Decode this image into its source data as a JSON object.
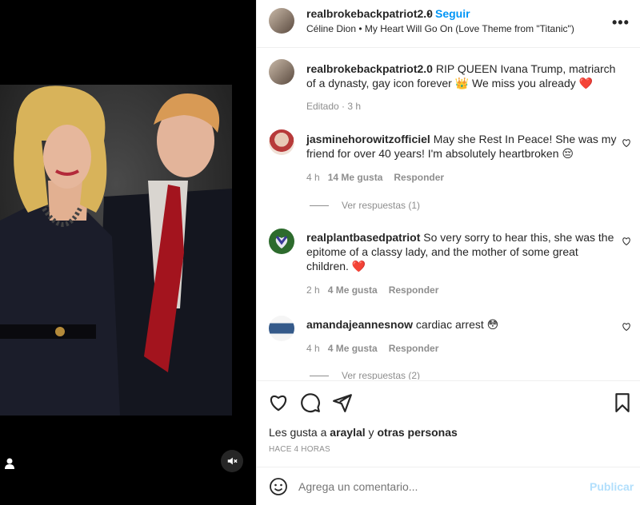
{
  "colors": {
    "accent": "#0095f6",
    "heart": "#ed4956",
    "muted": "#8e8e8e",
    "text": "#262626"
  },
  "media": {
    "user_tag_icon": "user-tag-icon",
    "mute_icon": "speaker-muted-icon"
  },
  "header": {
    "username": "realbrokebackpatriot2.0",
    "dot": "•",
    "follow_label": "Seguir",
    "music": "Céline Dion • My Heart Will Go On (Love Theme from \"Titanic\")",
    "more_icon": "more-options-icon",
    "more_label": "•••"
  },
  "caption": {
    "username": "realbrokebackpatriot2.0",
    "text": " RIP QUEEN Ivana Trump, matriarch of a dynasty, gay icon forever 👑  We miss you already ❤️",
    "meta": "Editado · 3 h"
  },
  "comments": [
    {
      "username": "jasminehorowitzofficiel",
      "text": " May she Rest In Peace! She was my friend for over 40 years! I'm absolutely heartbroken 😔",
      "time": "4 h",
      "likes": "14 Me gusta",
      "reply": "Responder",
      "view_replies": "Ver respuestas (1)"
    },
    {
      "username": "realplantbasedpatriot",
      "text": " So very sorry to hear this, she was the epitome of a classy lady, and the mother of some great children. ❤️",
      "time": "2 h",
      "likes": "4 Me gusta",
      "reply": "Responder"
    },
    {
      "username": "amandajeannesnow",
      "text": " cardiac arrest 😳",
      "time": "4 h",
      "likes": "4 Me gusta",
      "reply": "Responder",
      "view_replies": "Ver respuestas (2)"
    }
  ],
  "actions": {
    "like_icon": "heart-icon",
    "comment_icon": "comment-icon",
    "share_icon": "share-icon",
    "save_icon": "bookmark-icon",
    "likes_prefix": "Les gusta a ",
    "likes_user": "araylal",
    "likes_mid": " y ",
    "likes_others": "otras personas",
    "time": "HACE 4 HORAS"
  },
  "add_comment": {
    "placeholder": "Agrega un comentario...",
    "publish": "Publicar",
    "emoji_icon": "emoji-icon"
  }
}
